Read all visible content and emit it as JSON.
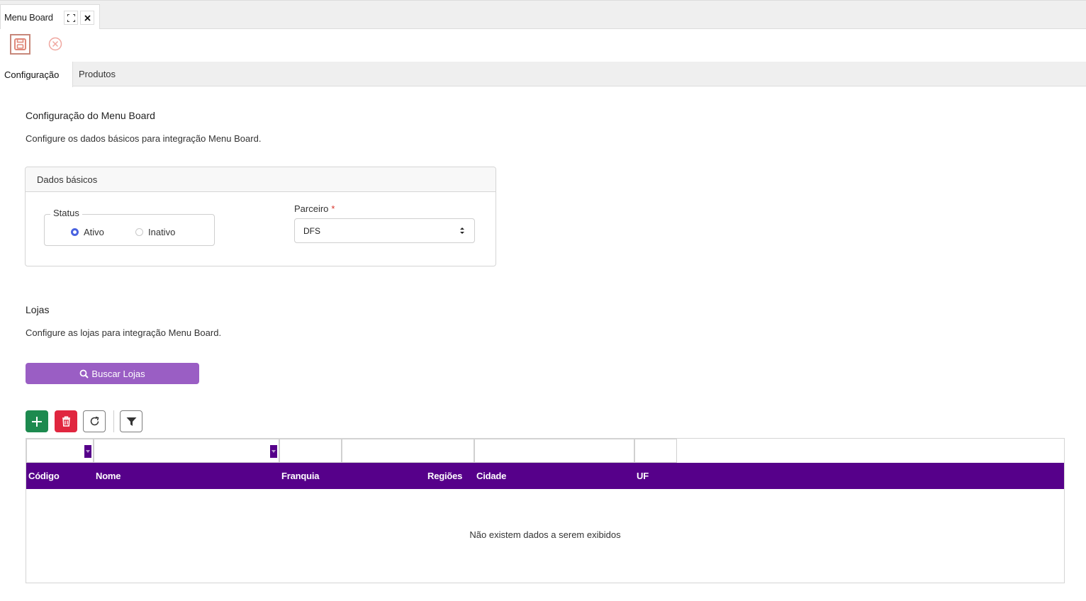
{
  "window": {
    "tab_title": "Menu Board",
    "expand_icon": "expand-icon",
    "close_icon": "close-icon"
  },
  "toolbar": {
    "save_icon": "floppy-disk-icon",
    "cancel_icon": "circle-x-icon"
  },
  "tabs": [
    {
      "label": "Configuração",
      "active": true
    },
    {
      "label": "Produtos",
      "active": false
    }
  ],
  "config_section": {
    "title": "Configuração do Menu Board",
    "description": "Configure os dados básicos para integração Menu Board."
  },
  "card": {
    "title": "Dados básicos",
    "status_label": "Status",
    "status_options": [
      {
        "label": "Ativo",
        "checked": true
      },
      {
        "label": "Inativo",
        "checked": false
      }
    ],
    "parceiro_label": "Parceiro",
    "parceiro_required": "*",
    "parceiro_value": "DFS"
  },
  "lojas_section": {
    "title": "Lojas",
    "description": "Configure as lojas para integração Menu Board.",
    "search_button": "Buscar Lojas"
  },
  "grid_toolbar": {
    "add_icon": "plus-icon",
    "delete_icon": "trash-icon",
    "refresh_icon": "refresh-icon",
    "filter_icon": "filter-icon"
  },
  "grid": {
    "columns": [
      "Código",
      "Nome",
      "Franquia",
      "Regiões",
      "Cidade",
      "UF"
    ],
    "empty_message": "Não existem dados a serem exibidos"
  },
  "colors": {
    "header_purple": "#56008a",
    "button_purple": "#9a5ec4",
    "add_green": "#1d8a4f",
    "delete_red": "#e0263f",
    "radio_blue": "#4a63e0"
  }
}
